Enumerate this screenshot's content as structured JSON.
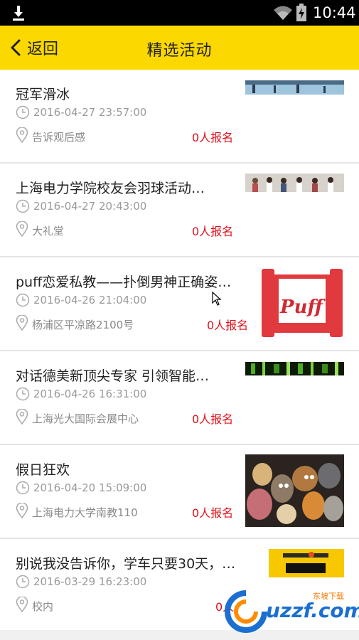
{
  "status_bar": {
    "time": "10:44",
    "icons": [
      "download-icon",
      "wifi-icon",
      "battery-icon"
    ]
  },
  "header": {
    "back_label": "返回",
    "title": "精选活动",
    "background": "#fbd800"
  },
  "items": [
    {
      "title": "冠军滑冰",
      "time": "2016-04-27 23:57:00",
      "location": "告诉观后感",
      "signup": "0人报名"
    },
    {
      "title": "上海电力学院校友会羽球活动…",
      "time": "2016-04-27 20:43:00",
      "location": "大礼堂",
      "signup": "0人报名"
    },
    {
      "title": "puff恋爱私教——扑倒男神正确姿…",
      "time": "2016-04-26 21:04:00",
      "location": "杨浦区平凉路2100号",
      "signup": "0人报名",
      "thumb_text": "Puff"
    },
    {
      "title": "对话德美新顶尖专家 引领智能…",
      "time": "2016-04-26 16:31:00",
      "location": "上海光大国际会展中心",
      "signup": "0人报名"
    },
    {
      "title": "假日狂欢",
      "time": "2016-04-20 15:09:00",
      "location": "上海电力大学南教110",
      "signup": "0人报名"
    },
    {
      "title": "别说我没告诉你，学车只要30天，…",
      "time": "2016-03-29 16:23:00",
      "location": "校内",
      "signup": "0人"
    }
  ],
  "watermark": {
    "text": "uzzf.com",
    "tag": "东坡下载"
  },
  "colors": {
    "accent": "#fbd800",
    "signup": "#e0101a",
    "meta": "#9a9a9a"
  }
}
